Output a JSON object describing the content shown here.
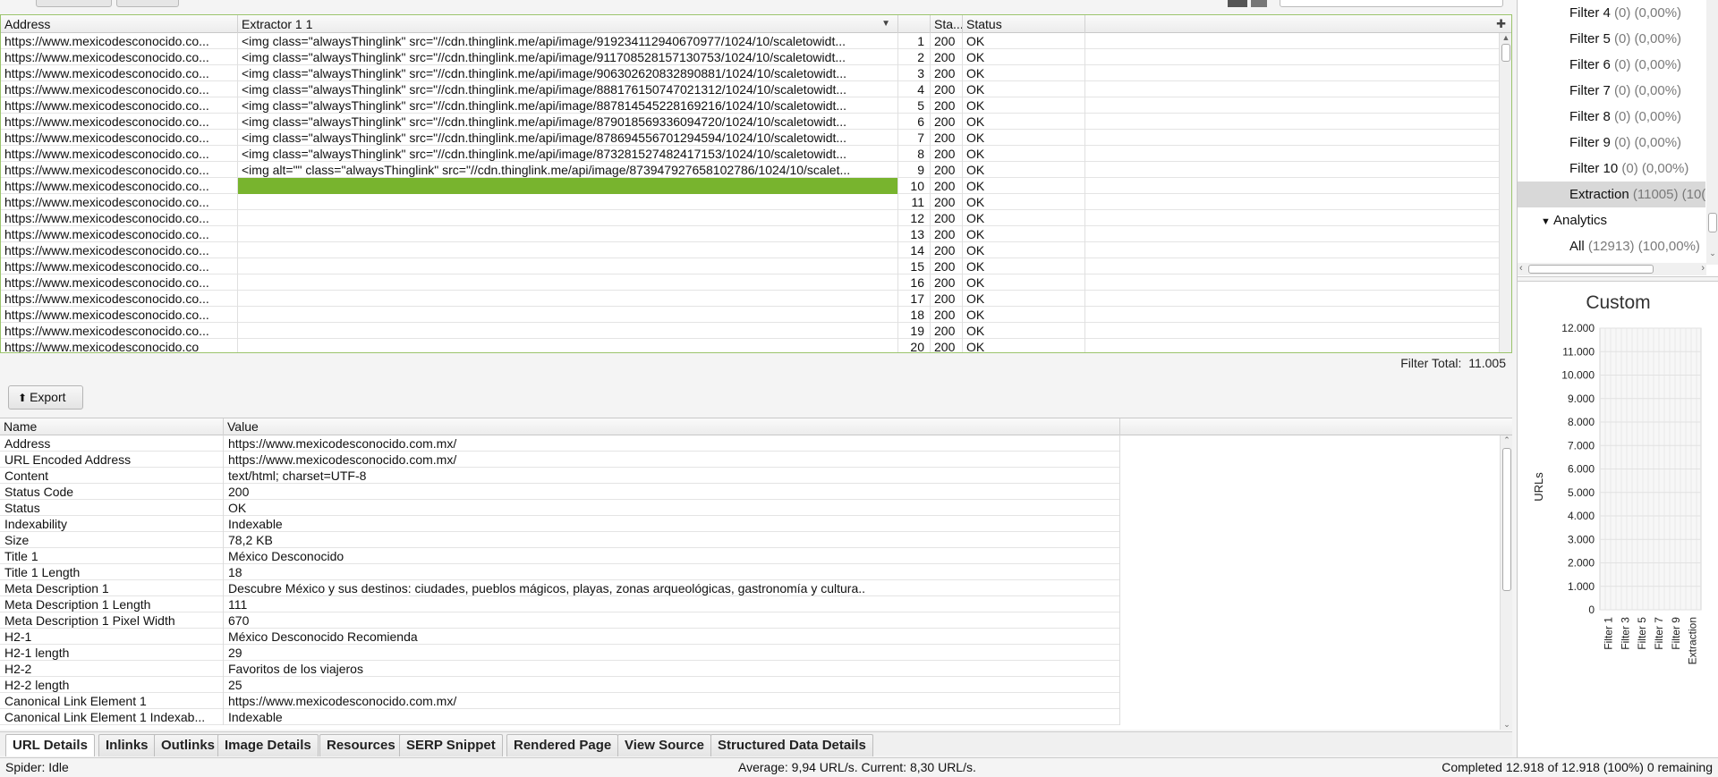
{
  "main_table": {
    "columns": [
      "Address",
      "Extractor 1 1",
      "",
      "Sta...",
      "Status"
    ],
    "rows": [
      {
        "address": "https://www.mexicodesconocido.co...",
        "extractor": "<img class=\"alwaysThinglink\" src=\"//cdn.thinglink.me/api/image/919234112940670977/1024/10/scaletowidt...",
        "idx": "1",
        "code": "200",
        "status": "OK"
      },
      {
        "address": "https://www.mexicodesconocido.co...",
        "extractor": "<img class=\"alwaysThinglink\" src=\"//cdn.thinglink.me/api/image/911708528157130753/1024/10/scaletowidt...",
        "idx": "2",
        "code": "200",
        "status": "OK"
      },
      {
        "address": "https://www.mexicodesconocido.co...",
        "extractor": "<img class=\"alwaysThinglink\" src=\"//cdn.thinglink.me/api/image/906302620832890881/1024/10/scaletowidt...",
        "idx": "3",
        "code": "200",
        "status": "OK"
      },
      {
        "address": "https://www.mexicodesconocido.co...",
        "extractor": "<img class=\"alwaysThinglink\" src=\"//cdn.thinglink.me/api/image/888176150747021312/1024/10/scaletowidt...",
        "idx": "4",
        "code": "200",
        "status": "OK"
      },
      {
        "address": "https://www.mexicodesconocido.co...",
        "extractor": "<img class=\"alwaysThinglink\" src=\"//cdn.thinglink.me/api/image/887814545228169216/1024/10/scaletowidt...",
        "idx": "5",
        "code": "200",
        "status": "OK"
      },
      {
        "address": "https://www.mexicodesconocido.co...",
        "extractor": "<img class=\"alwaysThinglink\" src=\"//cdn.thinglink.me/api/image/879018569336094720/1024/10/scaletowidt...",
        "idx": "6",
        "code": "200",
        "status": "OK"
      },
      {
        "address": "https://www.mexicodesconocido.co...",
        "extractor": "<img class=\"alwaysThinglink\" src=\"//cdn.thinglink.me/api/image/878694556701294594/1024/10/scaletowidt...",
        "idx": "7",
        "code": "200",
        "status": "OK"
      },
      {
        "address": "https://www.mexicodesconocido.co...",
        "extractor": "<img class=\"alwaysThinglink\" src=\"//cdn.thinglink.me/api/image/873281527482417153/1024/10/scaletowidt...",
        "idx": "8",
        "code": "200",
        "status": "OK"
      },
      {
        "address": "https://www.mexicodesconocido.co...",
        "extractor": "<img alt=\"\" class=\"alwaysThinglink\" src=\"//cdn.thinglink.me/api/image/873947927658102786/1024/10/scalet...",
        "idx": "9",
        "code": "200",
        "status": "OK"
      },
      {
        "address": "https://www.mexicodesconocido.co...",
        "extractor": "",
        "idx": "10",
        "code": "200",
        "status": "OK",
        "selected": true
      },
      {
        "address": "https://www.mexicodesconocido.co...",
        "extractor": "",
        "idx": "11",
        "code": "200",
        "status": "OK"
      },
      {
        "address": "https://www.mexicodesconocido.co...",
        "extractor": "",
        "idx": "12",
        "code": "200",
        "status": "OK"
      },
      {
        "address": "https://www.mexicodesconocido.co...",
        "extractor": "",
        "idx": "13",
        "code": "200",
        "status": "OK"
      },
      {
        "address": "https://www.mexicodesconocido.co...",
        "extractor": "",
        "idx": "14",
        "code": "200",
        "status": "OK"
      },
      {
        "address": "https://www.mexicodesconocido.co...",
        "extractor": "",
        "idx": "15",
        "code": "200",
        "status": "OK"
      },
      {
        "address": "https://www.mexicodesconocido.co...",
        "extractor": "",
        "idx": "16",
        "code": "200",
        "status": "OK"
      },
      {
        "address": "https://www.mexicodesconocido.co...",
        "extractor": "",
        "idx": "17",
        "code": "200",
        "status": "OK"
      },
      {
        "address": "https://www.mexicodesconocido.co...",
        "extractor": "",
        "idx": "18",
        "code": "200",
        "status": "OK"
      },
      {
        "address": "https://www.mexicodesconocido.co...",
        "extractor": "",
        "idx": "19",
        "code": "200",
        "status": "OK"
      },
      {
        "address": "https://www.mexicodesconocido.co",
        "extractor": "",
        "idx": "20",
        "code": "200",
        "status": "OK"
      }
    ]
  },
  "filter_total": {
    "label": "Filter Total:",
    "value": "11.005"
  },
  "export_label": "Export",
  "details": {
    "columns": [
      "Name",
      "Value"
    ],
    "rows": [
      {
        "name": "Address",
        "value": "https://www.mexicodesconocido.com.mx/"
      },
      {
        "name": "URL Encoded Address",
        "value": "https://www.mexicodesconocido.com.mx/"
      },
      {
        "name": "Content",
        "value": "text/html; charset=UTF-8"
      },
      {
        "name": "Status Code",
        "value": "200"
      },
      {
        "name": "Status",
        "value": "OK"
      },
      {
        "name": "Indexability",
        "value": "Indexable"
      },
      {
        "name": "Size",
        "value": "78,2 KB"
      },
      {
        "name": "Title 1",
        "value": "México Desconocido"
      },
      {
        "name": "Title 1 Length",
        "value": "18"
      },
      {
        "name": "Meta Description 1",
        "value": "Descubre México y sus destinos: ciudades, pueblos mágicos, playas, zonas arqueológicas, gastronomía y cultura.."
      },
      {
        "name": "Meta Description 1 Length",
        "value": "111"
      },
      {
        "name": "Meta Description 1 Pixel Width",
        "value": "670"
      },
      {
        "name": "H2-1",
        "value": "México Desconocido Recomienda"
      },
      {
        "name": "H2-1 length",
        "value": "29"
      },
      {
        "name": "H2-2",
        "value": "Favoritos de los viajeros"
      },
      {
        "name": "H2-2 length",
        "value": "25"
      },
      {
        "name": "Canonical Link Element 1",
        "value": "https://www.mexicodesconocido.com.mx/"
      },
      {
        "name": "Canonical Link Element 1 Indexab...",
        "value": "Indexable"
      }
    ]
  },
  "tabs": [
    "URL Details",
    "Inlinks",
    "Outlinks",
    "Image Details",
    "Resources",
    "SERP Snippet",
    "Rendered Page",
    "View Source",
    "Structured Data Details"
  ],
  "status": {
    "left": "Spider: Idle",
    "middle": "Average: 9,94 URL/s. Current: 8,30 URL/s.",
    "right": "Completed 12.918 of 12.918 (100%) 0 remaining"
  },
  "tree": {
    "items": [
      {
        "label": "Filter 4",
        "count": "(0) (0,00%)"
      },
      {
        "label": "Filter 5",
        "count": "(0) (0,00%)"
      },
      {
        "label": "Filter 6",
        "count": "(0) (0,00%)"
      },
      {
        "label": "Filter 7",
        "count": "(0) (0,00%)"
      },
      {
        "label": "Filter 8",
        "count": "(0) (0,00%)"
      },
      {
        "label": "Filter 9",
        "count": "(0) (0,00%)"
      },
      {
        "label": "Filter 10",
        "count": "(0) (0,00%)"
      },
      {
        "label": "Extraction",
        "count": "(11005) (10(",
        "selected": true
      },
      {
        "label": "Analytics",
        "count": "",
        "section": true
      },
      {
        "label": "All",
        "count": "(12913) (100,00%)"
      }
    ]
  },
  "chart_data": {
    "type": "bar",
    "title": "Custom",
    "ylabel": "URLs",
    "xlabel": "",
    "categories": [
      "Filter 1",
      "Filter 3",
      "Filter 5",
      "Filter 7",
      "Filter 9",
      "Extraction"
    ],
    "values": [
      0,
      0,
      0,
      0,
      0,
      0
    ],
    "ylim": [
      0,
      12000
    ],
    "yticks": [
      "0",
      "1.000",
      "2.000",
      "3.000",
      "4.000",
      "5.000",
      "6.000",
      "7.000",
      "8.000",
      "9.000",
      "10.000",
      "11.000",
      "12.000"
    ],
    "grid": true
  },
  "colors": {
    "selection": "#78b42e",
    "accent_border": "#9bc46c"
  }
}
